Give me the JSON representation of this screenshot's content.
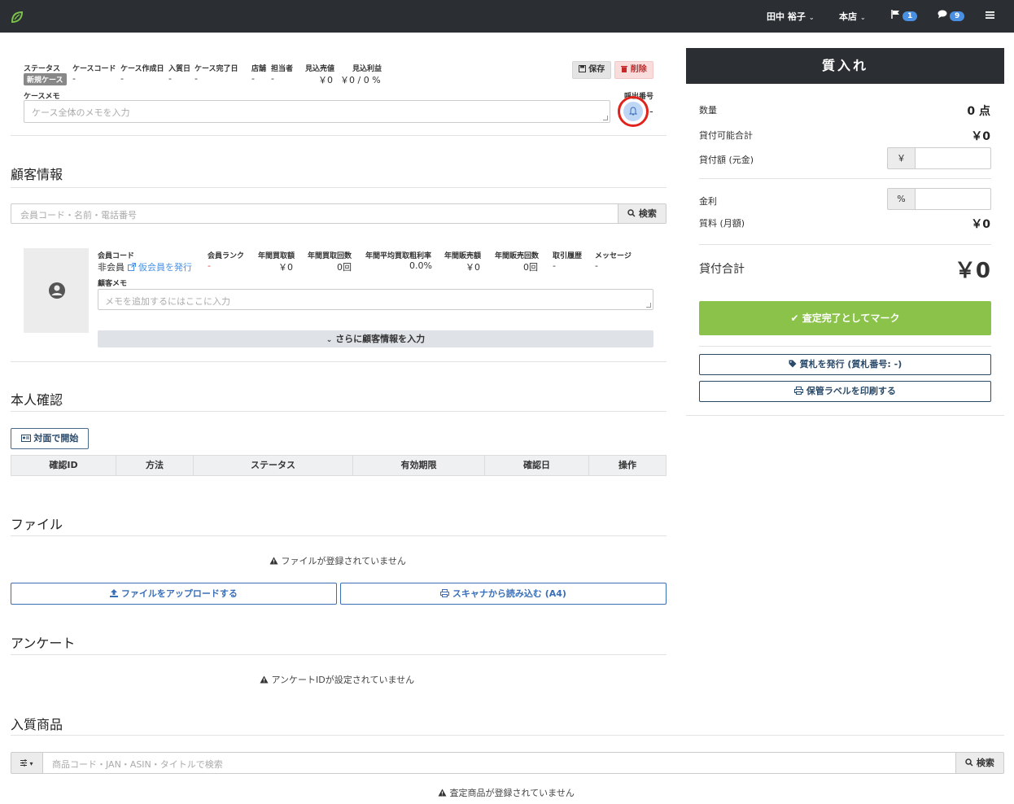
{
  "navbar": {
    "user_name": "田中 裕子",
    "store": "本店",
    "flag_count": "1",
    "message_count": "9"
  },
  "case": {
    "headers": [
      "ステータス",
      "ケースコード",
      "ケース作成日",
      "入質日",
      "ケース完了日",
      "店舗",
      "担当者",
      "見込売値",
      "見込利益"
    ],
    "status_badge": "新規ケース",
    "case_code": "-",
    "created_date": "-",
    "pawn_date": "-",
    "completed_date": "-",
    "store": "-",
    "staff": "-",
    "expected_price": "￥0",
    "expected_profit": "￥0 / 0 %",
    "save_label": "保存",
    "delete_label": "削除",
    "memo_label": "ケースメモ",
    "memo_placeholder": "ケース全体のメモを入力",
    "call_number_label": "呼出番号",
    "call_number_value": "-"
  },
  "customer": {
    "title": "顧客情報",
    "search_placeholder": "会員コード・名前・電話番号",
    "search_label": "検索",
    "headers": [
      "会員コード",
      "会員ランク",
      "年間買取額",
      "年間買取回数",
      "年間平均買取粗利率",
      "年間販売額",
      "年間販売回数",
      "取引履歴",
      "メッセージ"
    ],
    "member_status": "非会員",
    "issue_temp_link": "仮会員を発行",
    "rank": "-",
    "annual_purchase_amount": "￥0",
    "annual_purchase_count": "0回",
    "annual_margin_rate": "0.0%",
    "annual_sales_amount": "￥0",
    "annual_sales_count": "0回",
    "history": "-",
    "message": "-",
    "memo_label": "顧客メモ",
    "memo_placeholder": "メモを追加するにはここに入力",
    "more_label": "さらに顧客情報を入力"
  },
  "identity": {
    "title": "本人確認",
    "start_face_label": "対面で開始",
    "columns": [
      "確認ID",
      "方法",
      "ステータス",
      "有効期限",
      "確認日",
      "操作"
    ]
  },
  "files": {
    "title": "ファイル",
    "empty": "ファイルが登録されていません",
    "upload_label": "ファイルをアップロードする",
    "scan_label": "スキャナから読み込む (A4)"
  },
  "survey": {
    "title": "アンケート",
    "empty": "アンケートIDが設定されていません"
  },
  "products": {
    "title": "入質商品",
    "search_placeholder": "商品コード・JAN・ASIN・タイトルで検索",
    "search_label": "検索",
    "empty": "査定商品が登録されていません"
  },
  "panel": {
    "title": "質入れ",
    "quantity_label": "数量",
    "quantity_value": "0 点",
    "loanable_total_label": "貸付可能合計",
    "loanable_total_value": "￥0",
    "loan_amount_label": "貸付額 (元金)",
    "loan_amount_addon": "￥",
    "interest_label": "金利",
    "interest_addon": "%",
    "fee_label": "質料 (月額)",
    "fee_value": "￥0",
    "loan_total_label": "貸付合計",
    "loan_total_value": "￥0",
    "mark_complete_label": "査定完了としてマーク",
    "issue_ticket_label": "質札を発行 (質札番号: -)",
    "print_label": "保管ラベルを印刷する"
  },
  "colors": {
    "navbar": "#2b2f33",
    "primary": "#3a6fb8",
    "success": "#8bc34a",
    "danger": "#c62828"
  }
}
